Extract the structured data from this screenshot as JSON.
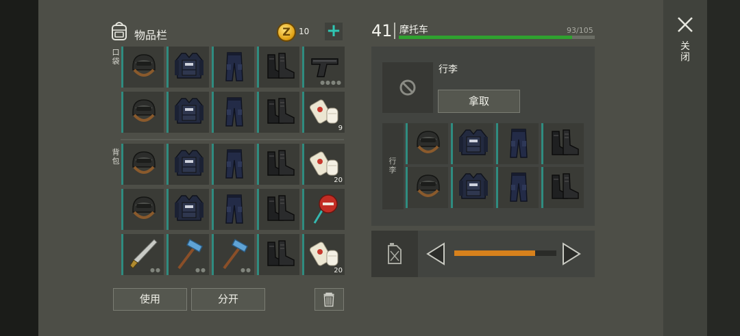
{
  "inventory": {
    "title": "物品栏",
    "coin_symbol": "Z",
    "coins": "10",
    "add_coins_icon": "plus-icon",
    "pockets_label": "口袋",
    "backpack_label": "背包",
    "pockets": [
      [
        {
          "item": "helmet"
        },
        {
          "item": "armor-vest"
        },
        {
          "item": "pants"
        },
        {
          "item": "boots"
        },
        {
          "item": "pistol",
          "durability_dots": 4
        }
      ],
      [
        {
          "item": "helmet"
        },
        {
          "item": "armor-vest"
        },
        {
          "item": "pants"
        },
        {
          "item": "boots"
        },
        {
          "item": "bandage",
          "count": "9"
        }
      ]
    ],
    "backpack": [
      [
        {
          "item": "helmet"
        },
        {
          "item": "armor-vest"
        },
        {
          "item": "pants"
        },
        {
          "item": "boots"
        },
        {
          "item": "bandage",
          "count": "20"
        }
      ],
      [
        {
          "item": "helmet"
        },
        {
          "item": "armor-vest"
        },
        {
          "item": "pants"
        },
        {
          "item": "boots"
        },
        {
          "item": "stop-sign"
        }
      ],
      [
        {
          "item": "machete",
          "durability_dots": 2
        },
        {
          "item": "hammer",
          "durability_dots": 2
        },
        {
          "item": "hammer",
          "durability_dots": 2
        },
        {
          "item": "boots"
        },
        {
          "item": "bandage",
          "count": "20"
        }
      ]
    ],
    "use_label": "使用",
    "split_label": "分开",
    "trash_icon": "trash-icon"
  },
  "vehicle": {
    "level": "41",
    "name": "摩托车",
    "durability": "93/105",
    "durability_fraction": 0.886,
    "hp_color": "#2fa12f",
    "trunk_title": "行李",
    "take_label": "拿取",
    "trunk_label": "行李",
    "trunk": [
      [
        {
          "item": "helmet"
        },
        {
          "item": "armor-vest"
        },
        {
          "item": "pants"
        },
        {
          "item": "boots"
        }
      ],
      [
        {
          "item": "helmet"
        },
        {
          "item": "armor-vest"
        },
        {
          "item": "pants"
        },
        {
          "item": "boots"
        }
      ]
    ],
    "fuel_fraction": 0.79,
    "fuel_color": "#d7811c"
  },
  "close_label": "关闭",
  "accent_color": "#2f8c80"
}
